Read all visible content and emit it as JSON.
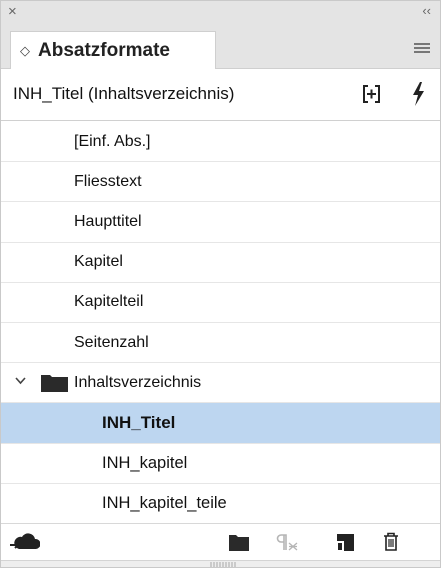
{
  "panel": {
    "close_glyph": "×",
    "collapse_glyph": "‹‹",
    "tab_sort_glyph": "◇",
    "tab_title": "Absatzformate",
    "menu_icon": "hamburger-menu-icon"
  },
  "header": {
    "current_style": "INH_Titel (Inhaltsverzeichnis)",
    "new_group_icon": "create-style-group-icon",
    "quick_apply_icon": "lightning-bolt-icon"
  },
  "styles": {
    "basic": "[Einf. Abs.]",
    "items": [
      "Fliesstext",
      "Haupttitel",
      "Kapitel",
      "Kapitelteil",
      "Seitenzahl"
    ],
    "group": {
      "name": "Inhaltsverzeichnis",
      "expanded": true,
      "items": [
        "INH_Titel",
        "INH_kapitel",
        "INH_kapitel_teile"
      ],
      "selected": "INH_Titel"
    }
  },
  "toolbar": {
    "icons": [
      "cloud-library-icon",
      "new-folder-icon",
      "clear-overrides-icon",
      "new-style-icon",
      "delete-icon"
    ]
  },
  "colors": {
    "selection": "#bdd6f0",
    "icon": "#222222",
    "icon_disabled": "#b5b5b5"
  }
}
